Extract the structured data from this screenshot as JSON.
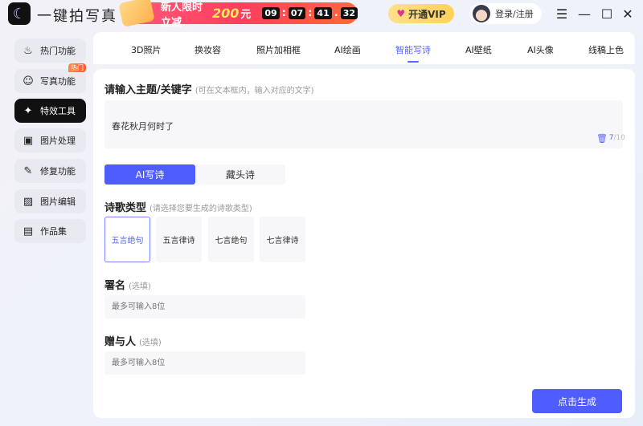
{
  "app": {
    "title": "一键拍写真",
    "logo_icon": "moon-star-icon"
  },
  "promo": {
    "text": "新人限时立减",
    "amount": "200",
    "unit": "元",
    "timer": [
      "09",
      "07",
      "41",
      "32"
    ],
    "seps": [
      ":",
      ":",
      "."
    ]
  },
  "vip": {
    "label": "开通VIP",
    "icon": "vip-diamond-icon"
  },
  "login": {
    "label": "登录/注册"
  },
  "window": {
    "menu": "☰",
    "min": "—",
    "max": "☐",
    "close": "✕"
  },
  "sidebar": {
    "items": [
      {
        "label": "热门功能",
        "icon": "fire-icon",
        "glyph": "♨"
      },
      {
        "label": "写真功能",
        "icon": "face-icon",
        "glyph": "☺",
        "badge": "热门"
      },
      {
        "label": "特效工具",
        "icon": "sparkle-icon",
        "glyph": "✦",
        "active": true
      },
      {
        "label": "图片处理",
        "icon": "image-edit-icon",
        "glyph": "▣"
      },
      {
        "label": "修复功能",
        "icon": "repair-icon",
        "glyph": "✎"
      },
      {
        "label": "图片编辑",
        "icon": "picture-icon",
        "glyph": "▨"
      },
      {
        "label": "作品集",
        "icon": "gallery-icon",
        "glyph": "▤"
      }
    ]
  },
  "tabs": [
    {
      "label": "3D照片"
    },
    {
      "label": "换妆容"
    },
    {
      "label": "照片加相框"
    },
    {
      "label": "AI绘画"
    },
    {
      "label": "智能写诗",
      "active": true
    },
    {
      "label": "AI壁纸"
    },
    {
      "label": "AI头像"
    },
    {
      "label": "线稿上色"
    }
  ],
  "form": {
    "topic_label": "请输入主题/关键字",
    "topic_hint": "(可在文本框内，输入对应的文字)",
    "topic_value": "春花秋月何时了",
    "count_current": "7",
    "count_max": "/10",
    "modes": [
      "AI写诗",
      "藏头诗"
    ],
    "type_label": "诗歌类型",
    "type_hint": "(请选择您要生成的诗歌类型)",
    "types": [
      "五言绝句",
      "五言律诗",
      "七言绝句",
      "七言律诗"
    ],
    "sign_label": "署名",
    "sign_hint": "(选填)",
    "sign_placeholder": "最多可输入8位",
    "to_label": "赠与人",
    "to_hint": "(选填)",
    "to_placeholder": "最多可输入8位",
    "submit": "点击生成"
  },
  "colors": {
    "accent": "#4f5dff"
  }
}
